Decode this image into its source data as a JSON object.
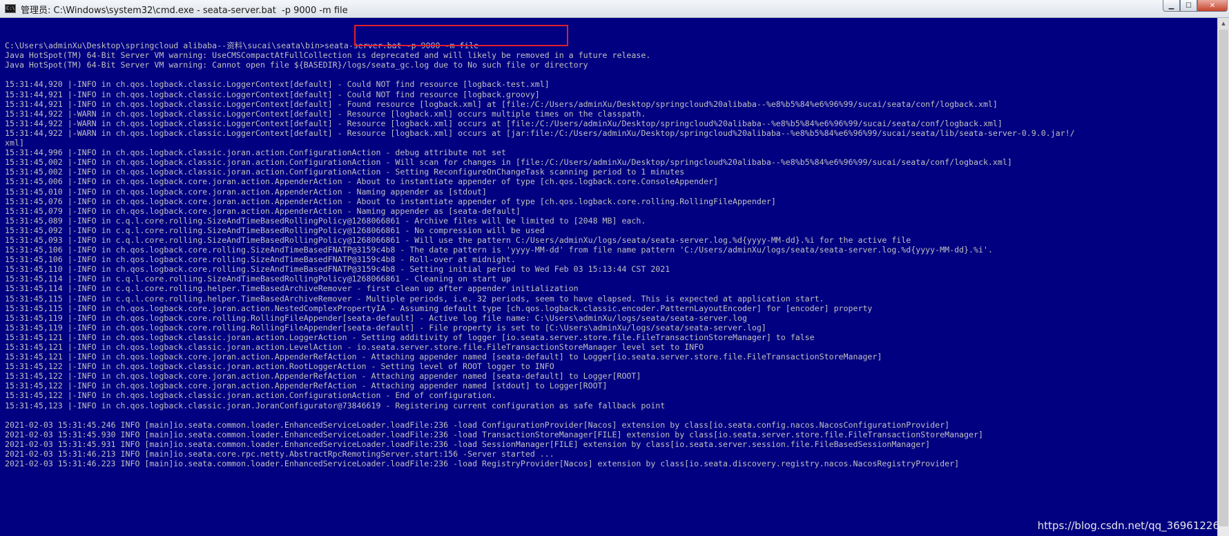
{
  "window": {
    "title": "管理员: C:\\Windows\\system32\\cmd.exe - seata-server.bat  -p 9000 -m file",
    "icon": "cmd-icon",
    "buttons": {
      "minimize": "▁",
      "maximize": "☐",
      "close": "✕"
    }
  },
  "colors": {
    "background": "#000080",
    "text": "#c0c0c0"
  },
  "console": {
    "lines": [
      "",
      "C:\\Users\\adminXu\\Desktop\\springcloud alibaba--资料\\sucai\\seata\\bin>seata-server.bat -p 9000 -m file",
      "Java HotSpot(TM) 64-Bit Server VM warning: UseCMSCompactAtFullCollection is deprecated and will likely be removed in a future release.",
      "Java HotSpot(TM) 64-Bit Server VM warning: Cannot open file ${BASEDIR}/logs/seata_gc.log due to No such file or directory",
      "",
      "15:31:44,920 |-INFO in ch.qos.logback.classic.LoggerContext[default] - Could NOT find resource [logback-test.xml]",
      "15:31:44,921 |-INFO in ch.qos.logback.classic.LoggerContext[default] - Could NOT find resource [logback.groovy]",
      "15:31:44,921 |-INFO in ch.qos.logback.classic.LoggerContext[default] - Found resource [logback.xml] at [file:/C:/Users/adminXu/Desktop/springcloud%20alibaba--%e8%b5%84%e6%96%99/sucai/seata/conf/logback.xml]",
      "15:31:44,922 |-WARN in ch.qos.logback.classic.LoggerContext[default] - Resource [logback.xml] occurs multiple times on the classpath.",
      "15:31:44,922 |-WARN in ch.qos.logback.classic.LoggerContext[default] - Resource [logback.xml] occurs at [file:/C:/Users/adminXu/Desktop/springcloud%20alibaba--%e8%b5%84%e6%96%99/sucai/seata/conf/logback.xml]",
      "15:31:44,922 |-WARN in ch.qos.logback.classic.LoggerContext[default] - Resource [logback.xml] occurs at [jar:file:/C:/Users/adminXu/Desktop/springcloud%20alibaba--%e8%b5%84%e6%96%99/sucai/seata/lib/seata-server-0.9.0.jar!/",
      "xml]",
      "15:31:44,996 |-INFO in ch.qos.logback.classic.joran.action.ConfigurationAction - debug attribute not set",
      "15:31:45,002 |-INFO in ch.qos.logback.classic.joran.action.ConfigurationAction - Will scan for changes in [file:/C:/Users/adminXu/Desktop/springcloud%20alibaba--%e8%b5%84%e6%96%99/sucai/seata/conf/logback.xml]",
      "15:31:45,002 |-INFO in ch.qos.logback.classic.joran.action.ConfigurationAction - Setting ReconfigureOnChangeTask scanning period to 1 minutes",
      "15:31:45,006 |-INFO in ch.qos.logback.core.joran.action.AppenderAction - About to instantiate appender of type [ch.qos.logback.core.ConsoleAppender]",
      "15:31:45,010 |-INFO in ch.qos.logback.core.joran.action.AppenderAction - Naming appender as [stdout]",
      "15:31:45,076 |-INFO in ch.qos.logback.core.joran.action.AppenderAction - About to instantiate appender of type [ch.qos.logback.core.rolling.RollingFileAppender]",
      "15:31:45,079 |-INFO in ch.qos.logback.core.joran.action.AppenderAction - Naming appender as [seata-default]",
      "15:31:45,089 |-INFO in c.q.l.core.rolling.SizeAndTimeBasedRollingPolicy@1268066861 - Archive files will be limited to [2048 MB] each.",
      "15:31:45,092 |-INFO in c.q.l.core.rolling.SizeAndTimeBasedRollingPolicy@1268066861 - No compression will be used",
      "15:31:45,093 |-INFO in c.q.l.core.rolling.SizeAndTimeBasedRollingPolicy@1268066861 - Will use the pattern C:/Users/adminXu/logs/seata/seata-server.log.%d{yyyy-MM-dd}.%i for the active file",
      "15:31:45,106 |-INFO in ch.qos.logback.core.rolling.SizeAndTimeBasedFNATP@3159c4b8 - The date pattern is 'yyyy-MM-dd' from file name pattern 'C:/Users/adminXu/logs/seata/seata-server.log.%d{yyyy-MM-dd}.%i'.",
      "15:31:45,106 |-INFO in ch.qos.logback.core.rolling.SizeAndTimeBasedFNATP@3159c4b8 - Roll-over at midnight.",
      "15:31:45,110 |-INFO in ch.qos.logback.core.rolling.SizeAndTimeBasedFNATP@3159c4b8 - Setting initial period to Wed Feb 03 15:13:44 CST 2021",
      "15:31:45,114 |-INFO in c.q.l.core.rolling.SizeAndTimeBasedRollingPolicy@1268066861 - Cleaning on start up",
      "15:31:45,114 |-INFO in c.q.l.core.rolling.helper.TimeBasedArchiveRemover - first clean up after appender initialization",
      "15:31:45,115 |-INFO in c.q.l.core.rolling.helper.TimeBasedArchiveRemover - Multiple periods, i.e. 32 periods, seem to have elapsed. This is expected at application start.",
      "15:31:45,115 |-INFO in ch.qos.logback.core.joran.action.NestedComplexPropertyIA - Assuming default type [ch.qos.logback.classic.encoder.PatternLayoutEncoder] for [encoder] property",
      "15:31:45,119 |-INFO in ch.qos.logback.core.rolling.RollingFileAppender[seata-default] - Active log file name: C:\\Users\\adminXu/logs/seata/seata-server.log",
      "15:31:45,119 |-INFO in ch.qos.logback.core.rolling.RollingFileAppender[seata-default] - File property is set to [C:\\Users\\adminXu/logs/seata/seata-server.log]",
      "15:31:45,121 |-INFO in ch.qos.logback.classic.joran.action.LoggerAction - Setting additivity of logger [io.seata.server.store.file.FileTransactionStoreManager] to false",
      "15:31:45,121 |-INFO in ch.qos.logback.classic.joran.action.LevelAction - io.seata.server.store.file.FileTransactionStoreManager level set to INFO",
      "15:31:45,121 |-INFO in ch.qos.logback.core.joran.action.AppenderRefAction - Attaching appender named [seata-default] to Logger[io.seata.server.store.file.FileTransactionStoreManager]",
      "15:31:45,122 |-INFO in ch.qos.logback.classic.joran.action.RootLoggerAction - Setting level of ROOT logger to INFO",
      "15:31:45,122 |-INFO in ch.qos.logback.core.joran.action.AppenderRefAction - Attaching appender named [seata-default] to Logger[ROOT]",
      "15:31:45,122 |-INFO in ch.qos.logback.core.joran.action.AppenderRefAction - Attaching appender named [stdout] to Logger[ROOT]",
      "15:31:45,122 |-INFO in ch.qos.logback.classic.joran.action.ConfigurationAction - End of configuration.",
      "15:31:45,123 |-INFO in ch.qos.logback.classic.joran.JoranConfigurator@73846619 - Registering current configuration as safe fallback point",
      "",
      "2021-02-03 15:31:45.246 INFO [main]io.seata.common.loader.EnhancedServiceLoader.loadFile:236 -load ConfigurationProvider[Nacos] extension by class[io.seata.config.nacos.NacosConfigurationProvider]",
      "2021-02-03 15:31:45.930 INFO [main]io.seata.common.loader.EnhancedServiceLoader.loadFile:236 -load TransactionStoreManager[FILE] extension by class[io.seata.server.store.file.FileTransactionStoreManager]",
      "2021-02-03 15:31:45.931 INFO [main]io.seata.common.loader.EnhancedServiceLoader.loadFile:236 -load SessionManager[FILE] extension by class[io.seata.server.session.file.FileBasedSessionManager]",
      "2021-02-03 15:31:46.213 INFO [main]io.seata.core.rpc.netty.AbstractRpcRemotingServer.start:156 -Server started ...",
      "2021-02-03 15:31:46.223 INFO [main]io.seata.common.loader.EnhancedServiceLoader.loadFile:236 -load RegistryProvider[Nacos] extension by class[io.seata.discovery.registry.nacos.NacosRegistryProvider]"
    ]
  },
  "watermark": "https://blog.csdn.net/qq_36961226"
}
